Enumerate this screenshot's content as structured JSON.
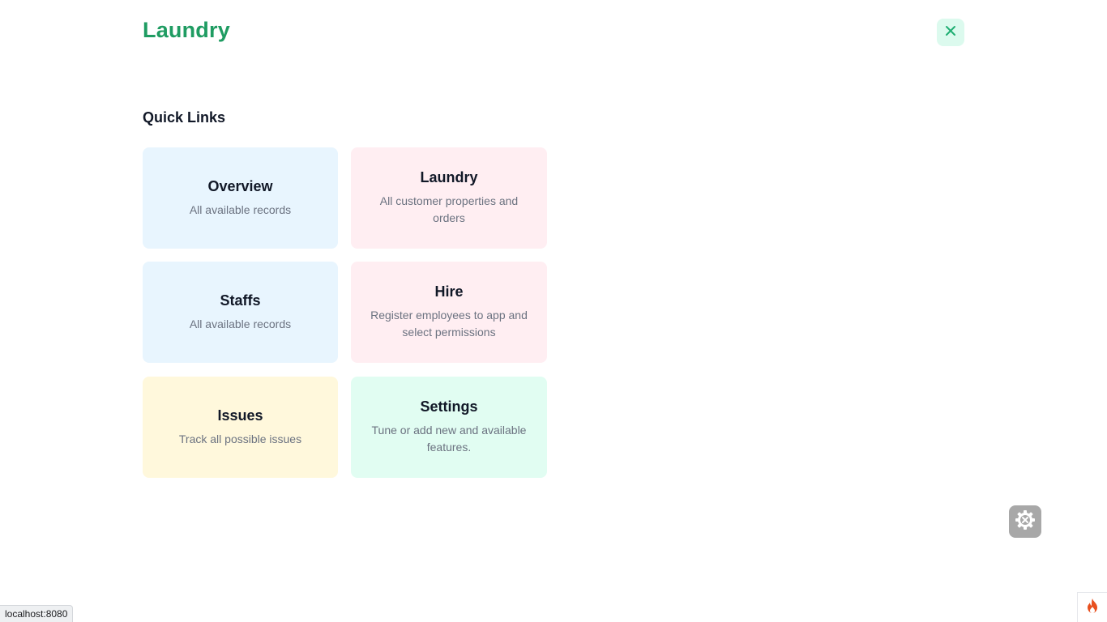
{
  "header": {
    "brand": "Laundry"
  },
  "section": {
    "title": "Quick Links"
  },
  "cards": [
    {
      "title": "Overview",
      "desc": "All available records"
    },
    {
      "title": "Laundry",
      "desc": "All customer properties and orders"
    },
    {
      "title": "Staffs",
      "desc": "All available records"
    },
    {
      "title": "Hire",
      "desc": "Register employees to app and select permissions"
    },
    {
      "title": "Issues",
      "desc": "Track all possible issues"
    },
    {
      "title": "Settings",
      "desc": "Tune or add new and available features."
    }
  ],
  "status_bar": {
    "url": "localhost:8080"
  },
  "icons": {
    "close": "close-icon",
    "settings_fab": "gear-icon",
    "corner": "flame-icon"
  },
  "colors": {
    "brand": "#1f9c62",
    "close_bg": "#dcfaee",
    "card_blue": "#e8f5fe",
    "card_pink": "#ffeef2",
    "card_yellow": "#fff8dc",
    "card_green": "#e1fdf2",
    "fab_bg": "#a8a8a8",
    "flame": "#e8501f"
  }
}
